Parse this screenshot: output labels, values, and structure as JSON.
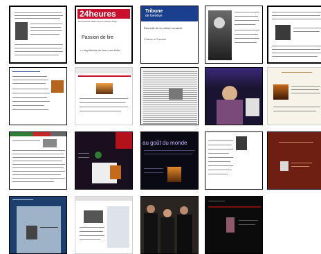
{
  "thumbnails": [
    {
      "id": "r1c1"
    },
    {
      "id": "r1c2",
      "logo": "24heures",
      "menu": "les dernières  éditions  sport  politique  blogs",
      "caption_title": "Passion de lire",
      "caption_sub": "Le blog littéraire de Jean-Louis Kuffer"
    },
    {
      "id": "r1c3",
      "logo_line1": "Tribune",
      "logo_line2": "de Genève",
      "headline": "Éternelle de la culture romande",
      "sub": "Chaîne et Paraole"
    },
    {
      "id": "r1c4"
    },
    {
      "id": "r1c5"
    },
    {
      "id": "r2c1"
    },
    {
      "id": "r2c2"
    },
    {
      "id": "r2c3"
    },
    {
      "id": "r2c4"
    },
    {
      "id": "r2c5"
    },
    {
      "id": "r3c1"
    },
    {
      "id": "r3c2"
    },
    {
      "id": "r3c3",
      "title": "au goût du monde"
    },
    {
      "id": "r3c4"
    },
    {
      "id": "r3c5"
    },
    {
      "id": "r4c1"
    },
    {
      "id": "r4c2"
    },
    {
      "id": "r4c3"
    },
    {
      "id": "r4c4"
    }
  ]
}
